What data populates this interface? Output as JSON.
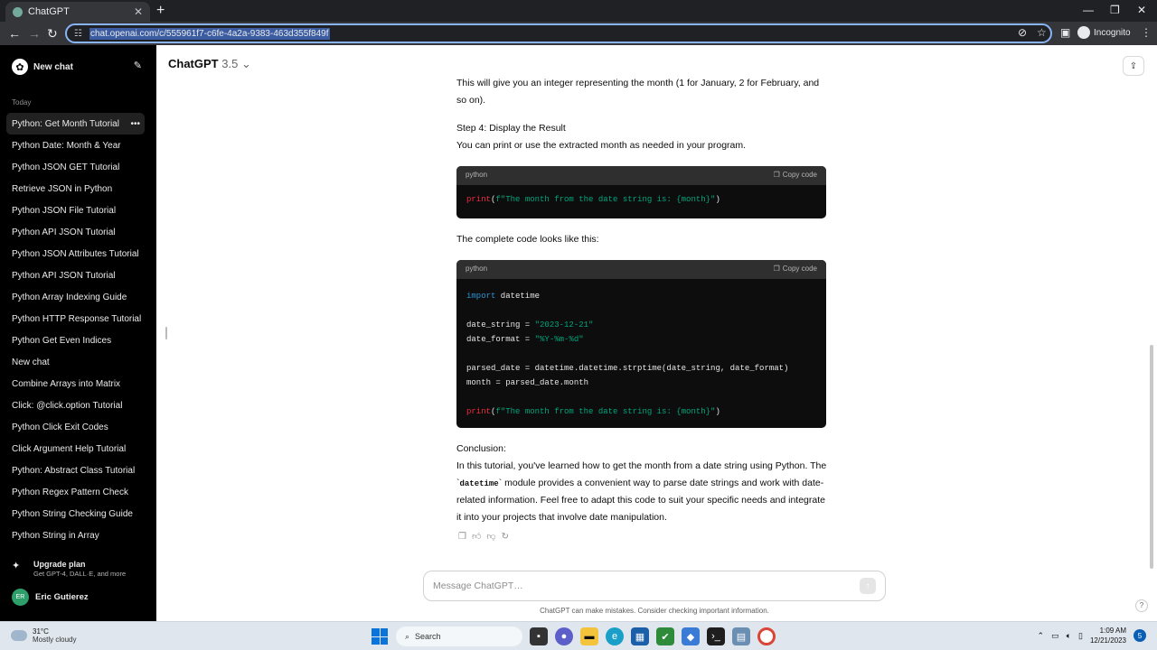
{
  "browser": {
    "tab_title": "ChatGPT",
    "tab_close": "✕",
    "new_tab": "+",
    "url": "chat.openai.com/c/555961f7-c6fe-4a2a-9383-463d355f849f",
    "incognito_label": "Incognito"
  },
  "sidebar": {
    "new_chat_label": "New chat",
    "section_label": "Today",
    "items": [
      "Python: Get Month Tutorial",
      "Python Date: Month & Year",
      "Python JSON GET Tutorial",
      "Retrieve JSON in Python",
      "Python JSON File Tutorial",
      "Python API JSON Tutorial",
      "Python JSON Attributes Tutorial",
      "Python API JSON Tutorial",
      "Python Array Indexing Guide",
      "Python HTTP Response Tutorial",
      "Python Get Even Indices",
      "New chat",
      "Combine Arrays into Matrix",
      "Click: @click.option Tutorial",
      "Python Click Exit Codes",
      "Click Argument Help Tutorial",
      "Python: Abstract Class Tutorial",
      "Python Regex Pattern Check",
      "Python String Checking Guide",
      "Python String in Array"
    ],
    "upgrade_title": "Upgrade plan",
    "upgrade_sub": "Get GPT-4, DALL·E, and more",
    "user_initials": "ER",
    "user_name": "Eric Gutierez"
  },
  "header": {
    "model_name": "ChatGPT",
    "model_version": "3.5",
    "model_chevron": "⌄"
  },
  "message": {
    "p1": "This will give you an integer representing the month (1 for January, 2 for February, and so on).",
    "step4_title": "Step 4: Display the Result",
    "step4_text": "You can print or use the extracted month as needed in your program.",
    "code1_lang": "python",
    "copy_label": "Copy code",
    "complete_text": "The complete code looks like this:",
    "code2_lang": "python",
    "conclusion_title": "Conclusion:",
    "conclusion_1": "In this tutorial, you've learned how to get the month from a date string using Python. The `",
    "conclusion_code": "datetime",
    "conclusion_2": "` module provides a convenient way to parse date strings and work with date-related information. Feel free to adapt this code to suit your specific needs and integrate it into your projects that involve date manipulation."
  },
  "composer": {
    "placeholder": "Message ChatGPT…",
    "disclaimer": "ChatGPT can make mistakes. Consider checking important information.",
    "help": "?"
  },
  "taskbar": {
    "temp": "31°C",
    "weather": "Mostly cloudy",
    "search_label": "Search",
    "time": "1:09 AM",
    "date": "12/21/2023",
    "notifications": "5"
  }
}
